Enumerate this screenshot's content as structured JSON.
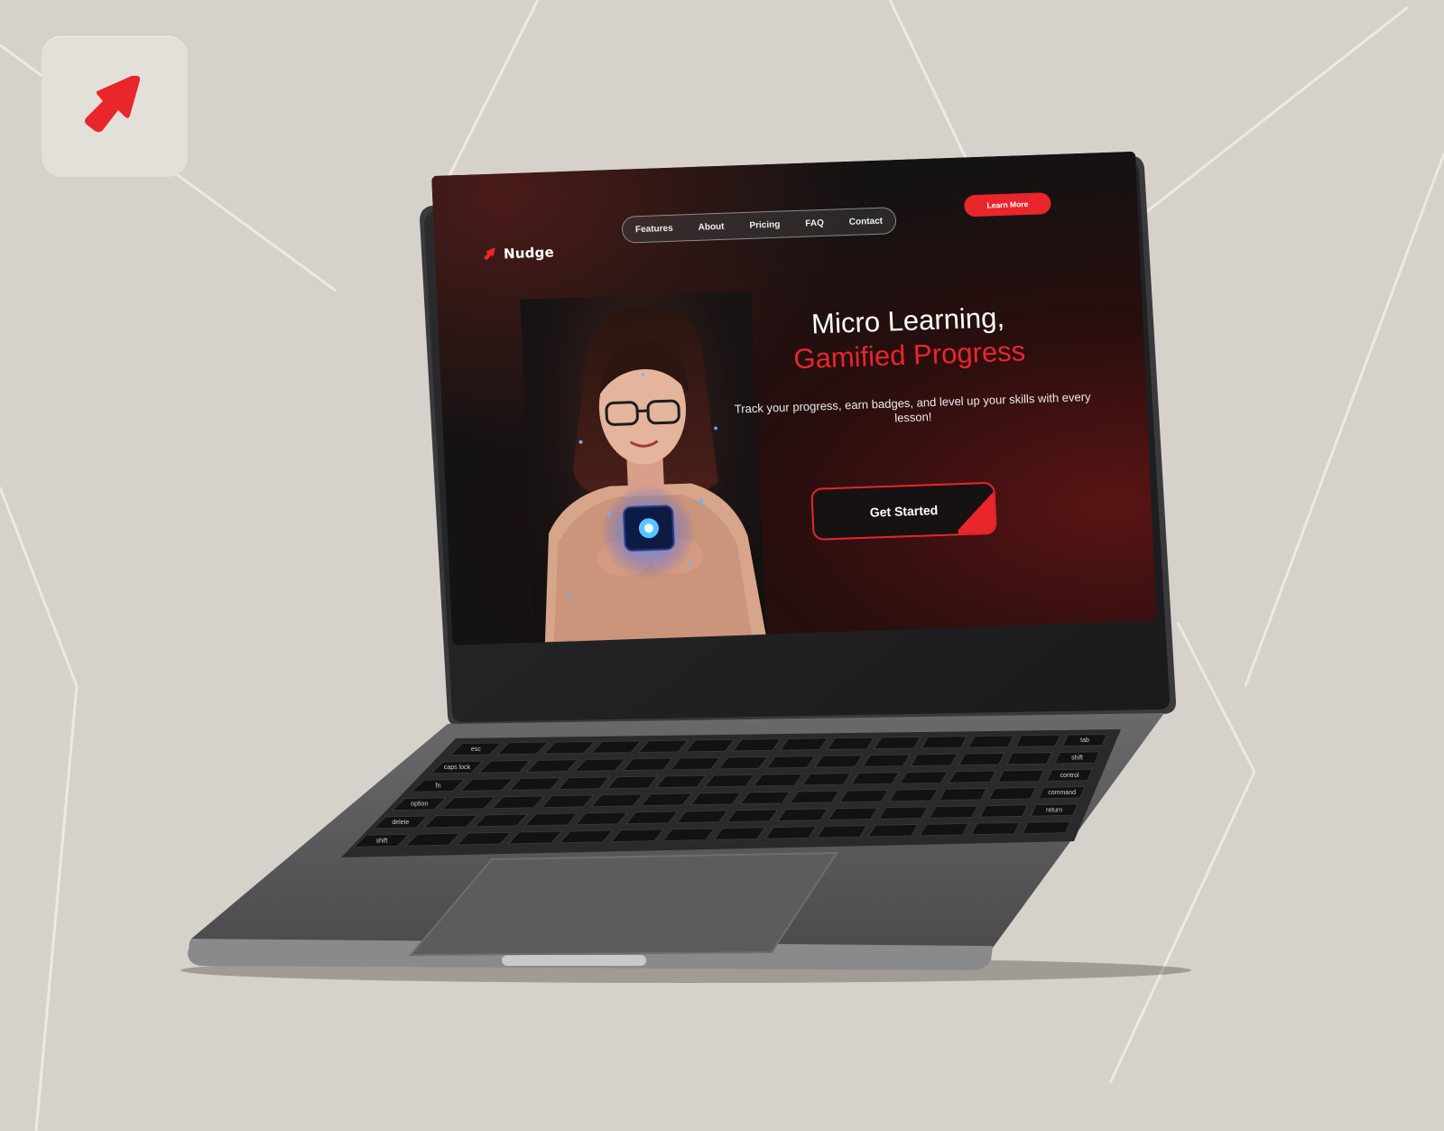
{
  "brand": {
    "name": "Nudge",
    "logo_icon": "red-arrow-cursor-icon",
    "accent_color": "#e8262b"
  },
  "nav": {
    "items": [
      "Features",
      "About",
      "Pricing",
      "FAQ",
      "Contact"
    ]
  },
  "header": {
    "cta_label": "Learn More"
  },
  "hero": {
    "title_line1": "Micro Learning,",
    "title_line2": "Gamified Progress",
    "subtitle": "Track your progress, earn badges, and level up your skills with every lesson!",
    "button_label": "Get Started",
    "image": "woman-holding-glowing-phone-photo"
  },
  "keyboard": {
    "keys": [
      "esc",
      "tab",
      "caps lock",
      "shift",
      "fn",
      "control",
      "option",
      "command",
      "delete",
      "return",
      "shift"
    ]
  }
}
